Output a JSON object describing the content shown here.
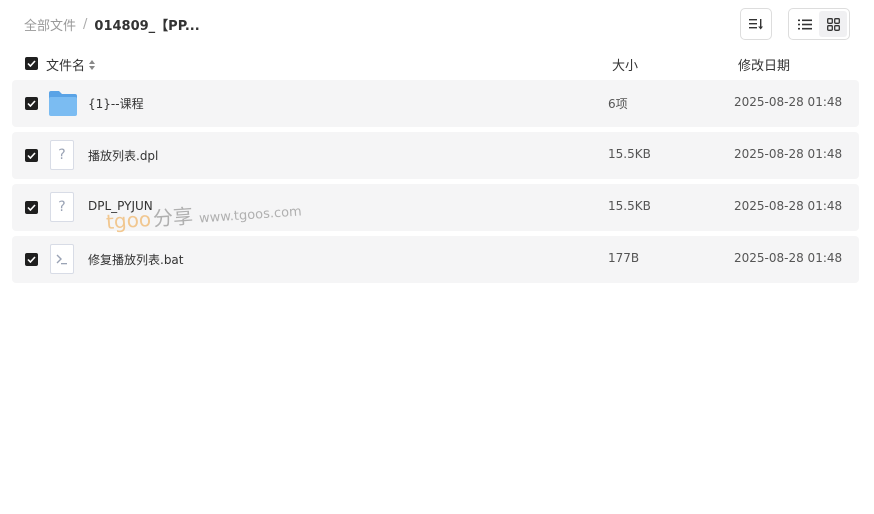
{
  "breadcrumb": {
    "root": "全部文件",
    "separator": "/",
    "current": "014809_【PP..."
  },
  "toolbar": {
    "sort_icon": "sort-list-icon",
    "view_list_icon": "list-view-icon",
    "view_grid_icon": "grid-view-icon",
    "active_view": "list"
  },
  "table": {
    "headers": {
      "name": "文件名",
      "size": "大小",
      "date": "修改日期"
    },
    "rows": [
      {
        "icon": "folder-icon",
        "name": "{1}--课程",
        "size": "6项",
        "date": "2025-08-28 01:48",
        "checked": true
      },
      {
        "icon": "unknown-file-icon",
        "name": "播放列表.dpl",
        "size": "15.5KB",
        "date": "2025-08-28 01:48",
        "checked": true
      },
      {
        "icon": "unknown-file-icon",
        "name": "DPL_PYJUN",
        "size": "15.5KB",
        "date": "2025-08-28 01:48",
        "checked": true
      },
      {
        "icon": "script-file-icon",
        "name": "修复播放列表.bat",
        "size": "177B",
        "date": "2025-08-28 01:48",
        "checked": true
      }
    ]
  },
  "watermark": {
    "brand": "tgoo",
    "cn": "分享",
    "url": "www.tgoos.com"
  },
  "colors": {
    "row_bg": "#f5f5f6",
    "checkbox": "#1f1f1f",
    "folder": "#6cb4f0",
    "watermark_brand": "#f0b86e"
  }
}
